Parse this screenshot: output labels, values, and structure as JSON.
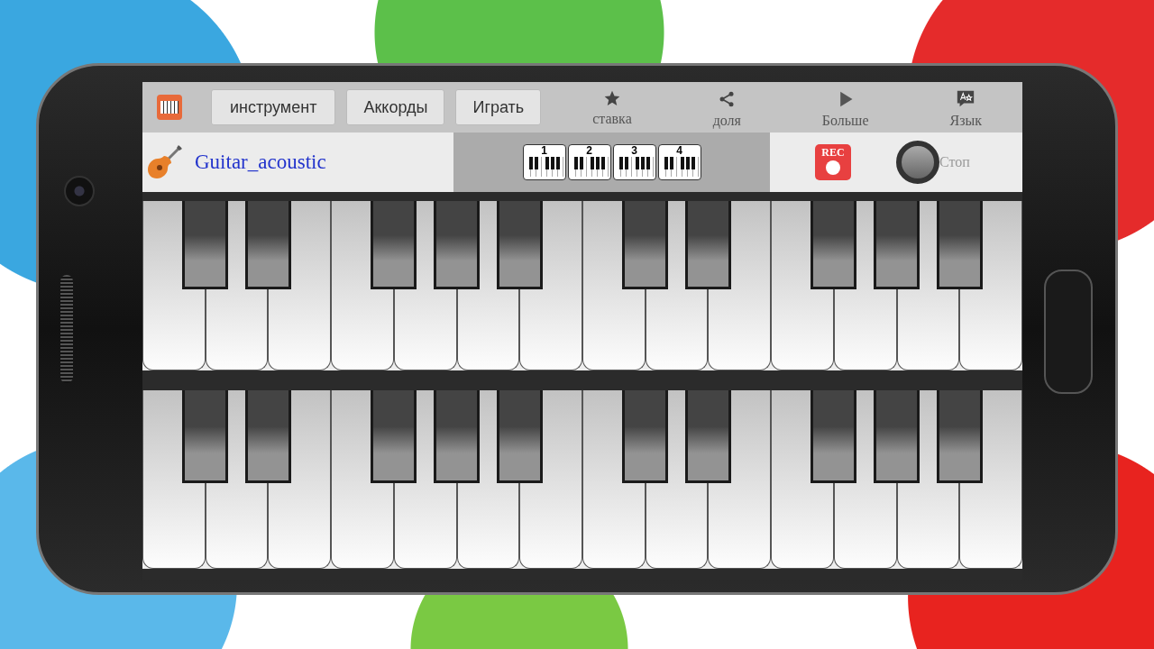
{
  "toolbar": {
    "buttons": [
      "инструмент",
      "Аккорды",
      "Играть"
    ],
    "actions": [
      {
        "kind": "star",
        "label": "ставка"
      },
      {
        "kind": "share",
        "label": "доля"
      },
      {
        "kind": "play",
        "label": "Больше"
      },
      {
        "kind": "language",
        "label": "Язык"
      }
    ]
  },
  "instrument": {
    "name": "Guitar_acoustic"
  },
  "octaves": [
    "1",
    "2",
    "3",
    "4"
  ],
  "record": {
    "label": "REC"
  },
  "stop": {
    "label": "Стоп"
  }
}
